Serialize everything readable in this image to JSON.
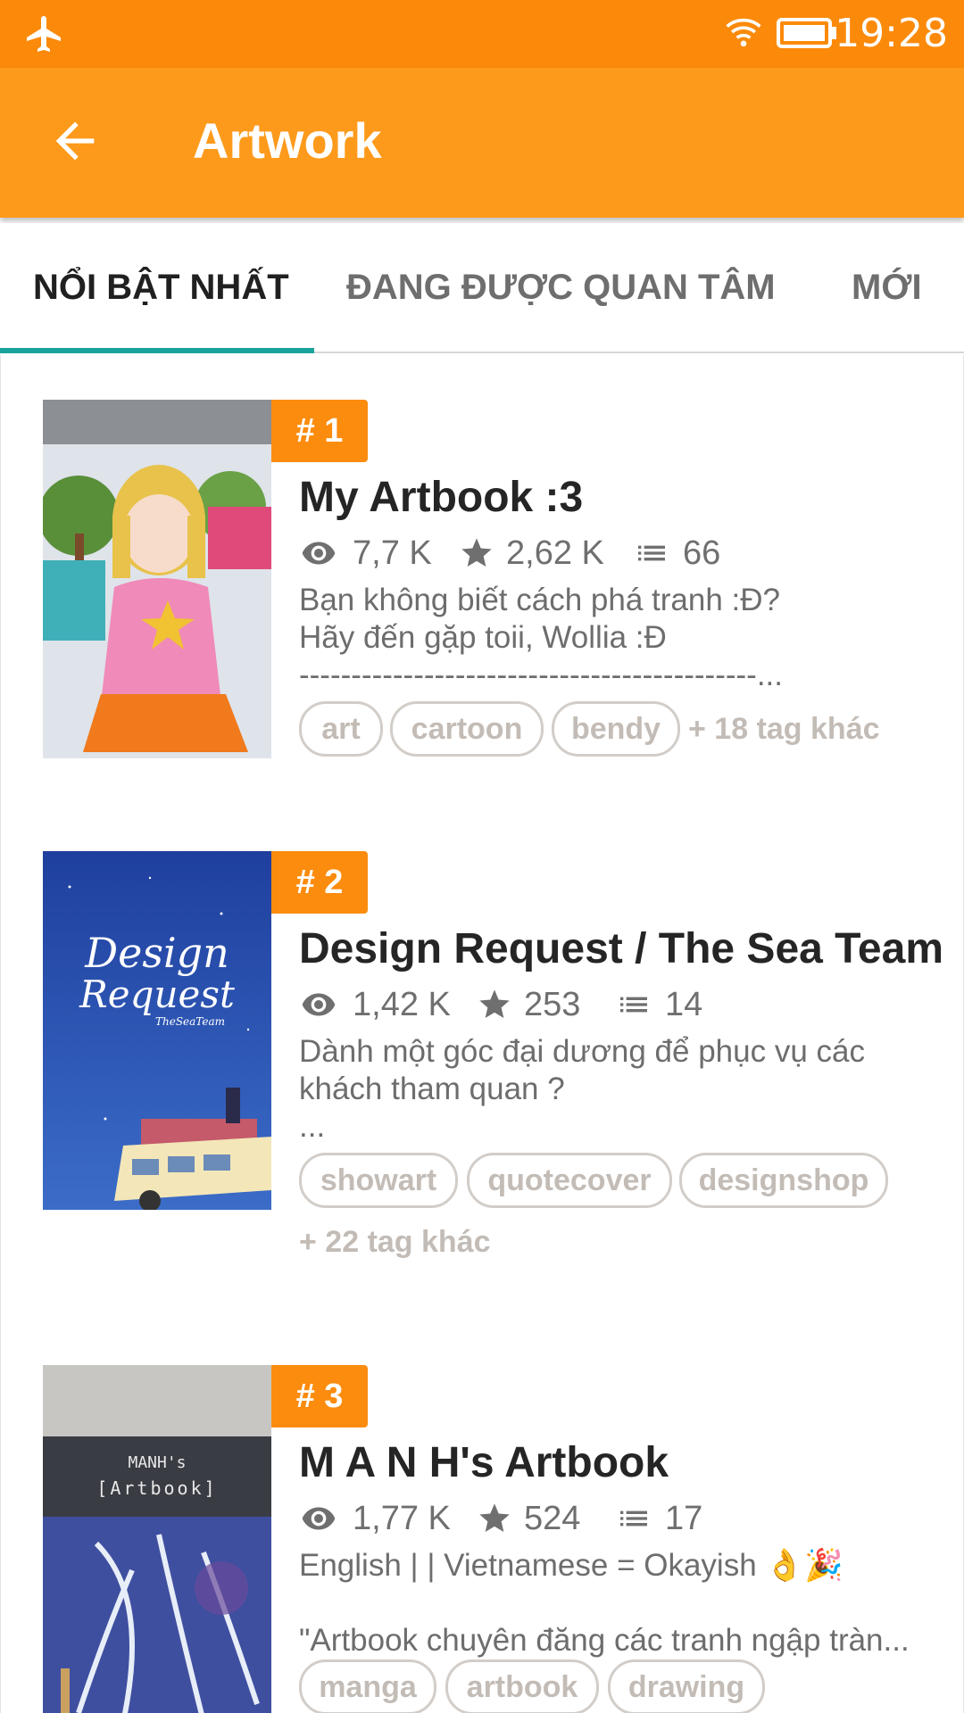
{
  "status_bar": {
    "time": "19:28",
    "icons": [
      "airplane-icon",
      "wifi-icon",
      "battery-icon"
    ]
  },
  "app_bar": {
    "title": "Artwork",
    "back_icon": "arrow-left-icon"
  },
  "tabs": [
    {
      "label": "NỔI BẬT NHẤT",
      "active": true
    },
    {
      "label": "ĐANG ĐƯỢC QUAN TÂM",
      "active": false
    },
    {
      "label": "MỚI",
      "active": false
    }
  ],
  "stories": [
    {
      "rank": "# 1",
      "title": "My Artbook :3",
      "views": "7,7 K",
      "votes": "2,62 K",
      "parts": "66",
      "description": [
        "Bạn không biết cách phá tranh :Đ?",
        "Hãy đến gặp toii, Wollia :Đ",
        "--------------------------------------------..."
      ],
      "tags": [
        "art",
        "cartoon",
        "bendy"
      ],
      "more_tags": "+ 18 tag khác"
    },
    {
      "rank": "# 2",
      "title": " Design Request / The Sea Team",
      "views": "1,42 K",
      "votes": "253",
      "parts": "14",
      "description": [
        "Dành một góc đại dương để phục vụ các",
        "khách tham quan ?",
        "..."
      ],
      "tags": [
        "showart",
        "quotecover",
        "designshop"
      ],
      "more_tags": "+ 22 tag khác",
      "cover_text": [
        "Design",
        "Request",
        "TheSeaTeam"
      ]
    },
    {
      "rank": "# 3",
      "title": "M A N H's Artbook",
      "views": "1,77 K",
      "votes": "524",
      "parts": "17",
      "description": [
        "English | | Vietnamese = Okayish 👌🎉",
        "",
        "\"Artbook chuyên đăng các tranh ngập tràn..."
      ],
      "tags": [
        "manga",
        "artbook",
        "drawing"
      ],
      "more_tags": "",
      "cover_text": [
        "MANH's",
        "[Artbook]"
      ]
    }
  ],
  "colors": {
    "status_bar": "#fb8a0a",
    "app_bar": "#fe9a1b",
    "rank_badge": "#fb8c0e",
    "tab_indicator": "#1aa39a"
  }
}
